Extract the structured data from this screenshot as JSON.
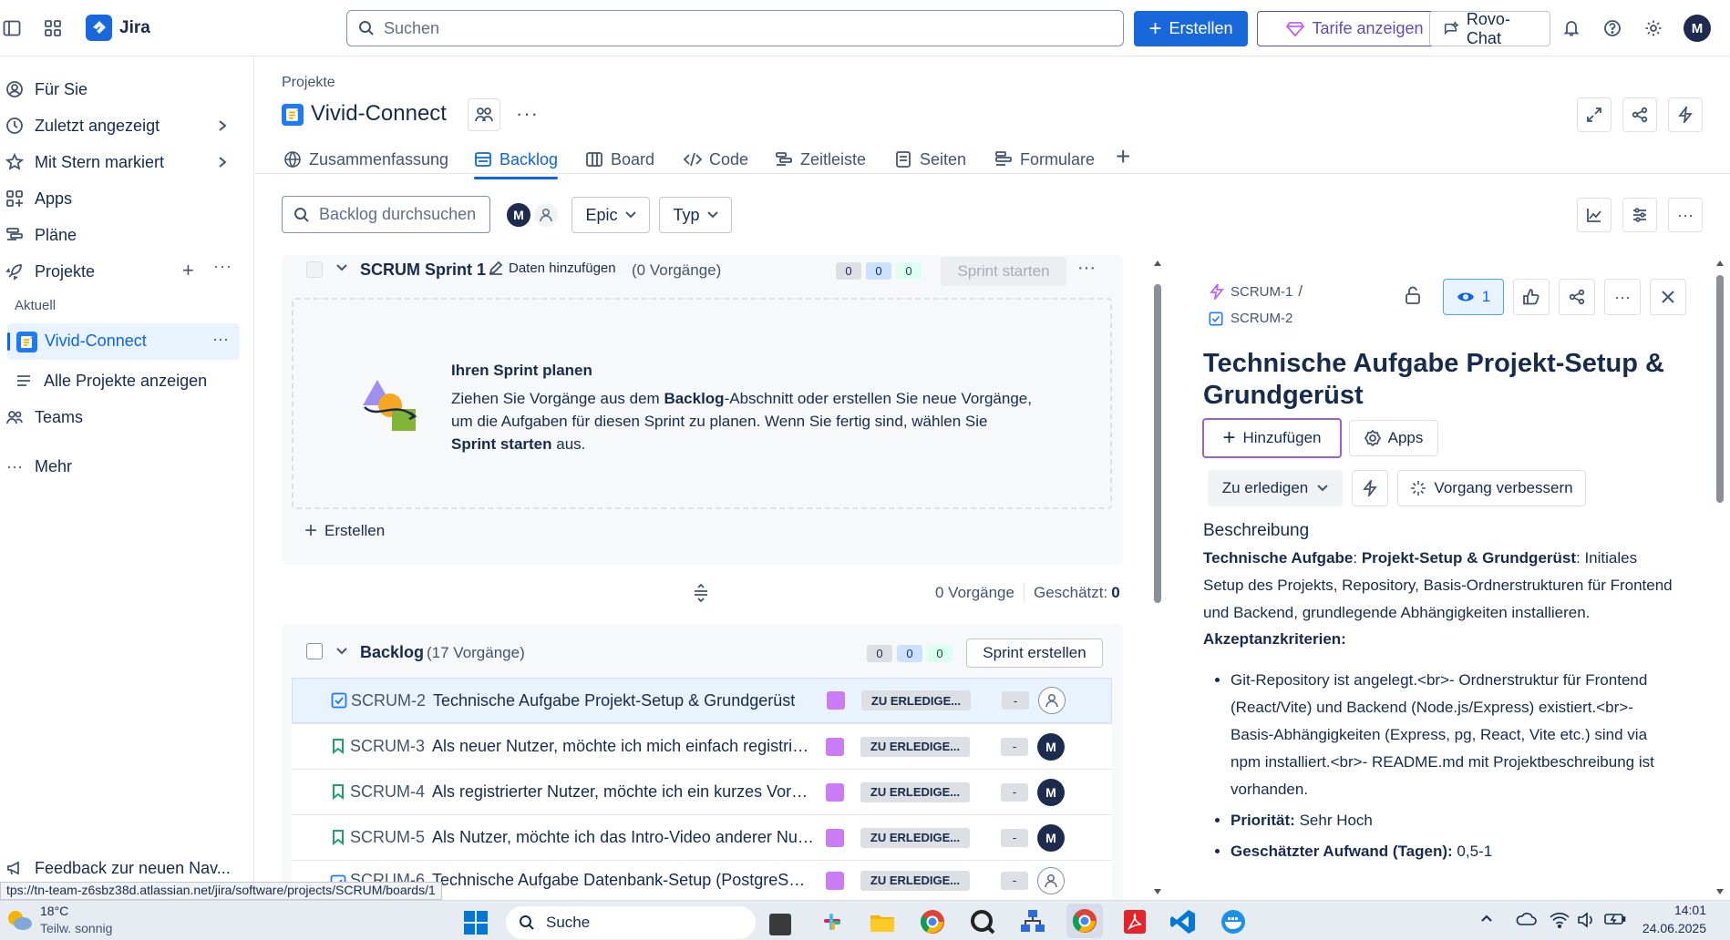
{
  "topbar": {
    "app_name": "Jira",
    "search_placeholder": "Suchen",
    "create_label": "Erstellen",
    "plans_label": "Tarife anzeigen",
    "rovo_label": "Rovo-Chat",
    "avatar_initial": "M"
  },
  "sidebar": {
    "items": [
      {
        "label": "Für Sie"
      },
      {
        "label": "Zuletzt angezeigt"
      },
      {
        "label": "Mit Stern markiert"
      },
      {
        "label": "Apps"
      },
      {
        "label": "Pläne"
      },
      {
        "label": "Projekte"
      }
    ],
    "section_current": "Aktuell",
    "current_project": "Vivid-Connect",
    "all_projects": "Alle Projekte anzeigen",
    "teams": "Teams",
    "more": "Mehr",
    "feedback": "Feedback zur neuen Nav..."
  },
  "project": {
    "breadcrumb": "Projekte",
    "name": "Vivid-Connect",
    "tabs": [
      {
        "label": "Zusammenfassung"
      },
      {
        "label": "Backlog"
      },
      {
        "label": "Board"
      },
      {
        "label": "Code"
      },
      {
        "label": "Zeitleiste"
      },
      {
        "label": "Seiten"
      },
      {
        "label": "Formulare"
      }
    ]
  },
  "filters": {
    "search_placeholder": "Backlog durchsuchen",
    "avatar_initial": "M",
    "epic": "Epic",
    "type": "Typ"
  },
  "sprint": {
    "title": "SCRUM Sprint 1",
    "add_dates": "Daten hinzufügen",
    "count": "(0 Vorgänge)",
    "pill_grey": "0",
    "pill_blue": "0",
    "pill_green": "0",
    "start_button": "Sprint starten",
    "empty_title": "Ihren Sprint planen",
    "empty_line1_a": "Ziehen Sie Vorgänge aus dem ",
    "empty_line1_b": "Backlog",
    "empty_line1_c": "-Abschnitt oder erstellen Sie neue Vorgänge,",
    "empty_line2": "um die Aufgaben für diesen Sprint zu planen. Wenn Sie fertig sind, wählen Sie",
    "empty_line3_a": "Sprint starten",
    "empty_line3_b": " aus.",
    "create_label": "Erstellen",
    "summary_issues": "0 Vorgänge",
    "summary_estimate_label": "Geschätzt:",
    "summary_estimate_value": "0"
  },
  "backlog": {
    "title": "Backlog",
    "count": "(17 Vorgänge)",
    "pill_grey": "0",
    "pill_blue": "0",
    "pill_green": "0",
    "create_sprint": "Sprint erstellen",
    "issues": [
      {
        "key": "SCRUM-2",
        "summary": "Technische Aufgabe Projekt-Setup & Grundgerüst",
        "status": "ZU ERLEDIGE...",
        "estimate": "-",
        "assignee": ""
      },
      {
        "key": "SCRUM-3",
        "summary": "Als neuer Nutzer, möchte ich mich einfach registrieren...",
        "status": "ZU ERLEDIGE...",
        "estimate": "-",
        "assignee": "M"
      },
      {
        "key": "SCRUM-4",
        "summary": "Als registrierter Nutzer, möchte ich ein kurzes Vorstellungsvideo...",
        "status": "ZU ERLEDIGE...",
        "estimate": "-",
        "assignee": "M"
      },
      {
        "key": "SCRUM-5",
        "summary": "Als Nutzer, möchte ich das Intro-Video anderer Nutzer...",
        "status": "ZU ERLEDIGE...",
        "estimate": "-",
        "assignee": "M"
      },
      {
        "key": "SCRUM-6",
        "summary": "Technische Aufgabe Datenbank-Setup (PostgreSQL)",
        "status": "ZU ERLEDIGE...",
        "estimate": "-",
        "assignee": ""
      }
    ]
  },
  "detail": {
    "parent_key": "SCRUM-1",
    "key": "SCRUM-2",
    "watch_count": "1",
    "title": "Technische Aufgabe Projekt-Setup & Grundgerüst",
    "add_label": "Hinzufügen",
    "apps_label": "Apps",
    "status_label": "Zu erledigen",
    "improve_label": "Vorgang verbessern",
    "description_heading": "Beschreibung",
    "desc_bold1": "Technische Aufgabe",
    "desc_sep": ": ",
    "desc_bold2": "Projekt-Setup & Grundgerüst",
    "desc_rest": ": Initiales Setup des Projekts, Repository, Basis-Ordnerstrukturen für Frontend und Backend, grundlegende Abhängigkeiten installieren.",
    "acceptance_heading": "Akzeptanzkriterien:",
    "bullet1": "Git-Repository ist angelegt.<br>- Ordnerstruktur für Frontend (React/Vite) und Backend (Node.js/Express) existiert.<br>- Basis-Abhängigkeiten (Express, pg, React, Vite etc.) sind via npm installiert.<br>- README.md mit Projektbeschreibung ist vorhanden.",
    "bullet2_label": "Priorität:",
    "bullet2_value": " Sehr Hoch",
    "bullet3_label": "Geschätzter Aufwand (Tagen):",
    "bullet3_value": " 0,5-1"
  },
  "statusbar": {
    "url": "tps://tn-team-z6sbz38d.atlassian.net/jira/software/projects/SCRUM/boards/1"
  },
  "taskbar": {
    "temp": "18°C",
    "weather": "Teilw. sonnig",
    "search": "Suche",
    "time": "14:01",
    "date": "24.06.2025"
  },
  "colors": {
    "brand_blue": "#0c66e4",
    "epic_purple": "#c97cf4",
    "discovery_purple": "#a54800"
  }
}
